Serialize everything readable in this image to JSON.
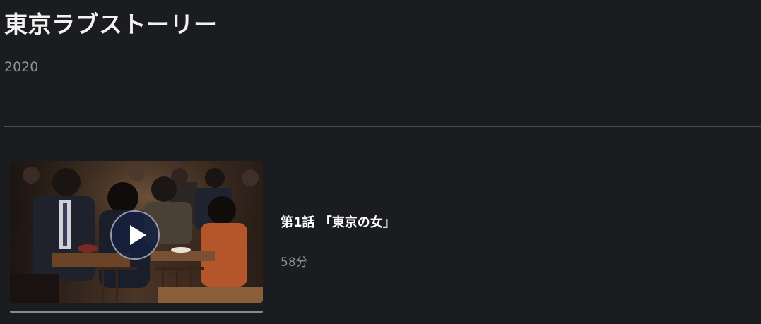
{
  "series": {
    "title": "東京ラブストーリー",
    "year": "2020"
  },
  "episodes": [
    {
      "title": "第1話 「東京の女」",
      "duration": "58分",
      "thumbnail_icon": "play-icon"
    }
  ],
  "colors": {
    "background": "#1b1c20",
    "divider": "#4a4b50",
    "muted_text": "#8e8f94",
    "play_button_bg": "#162140"
  }
}
